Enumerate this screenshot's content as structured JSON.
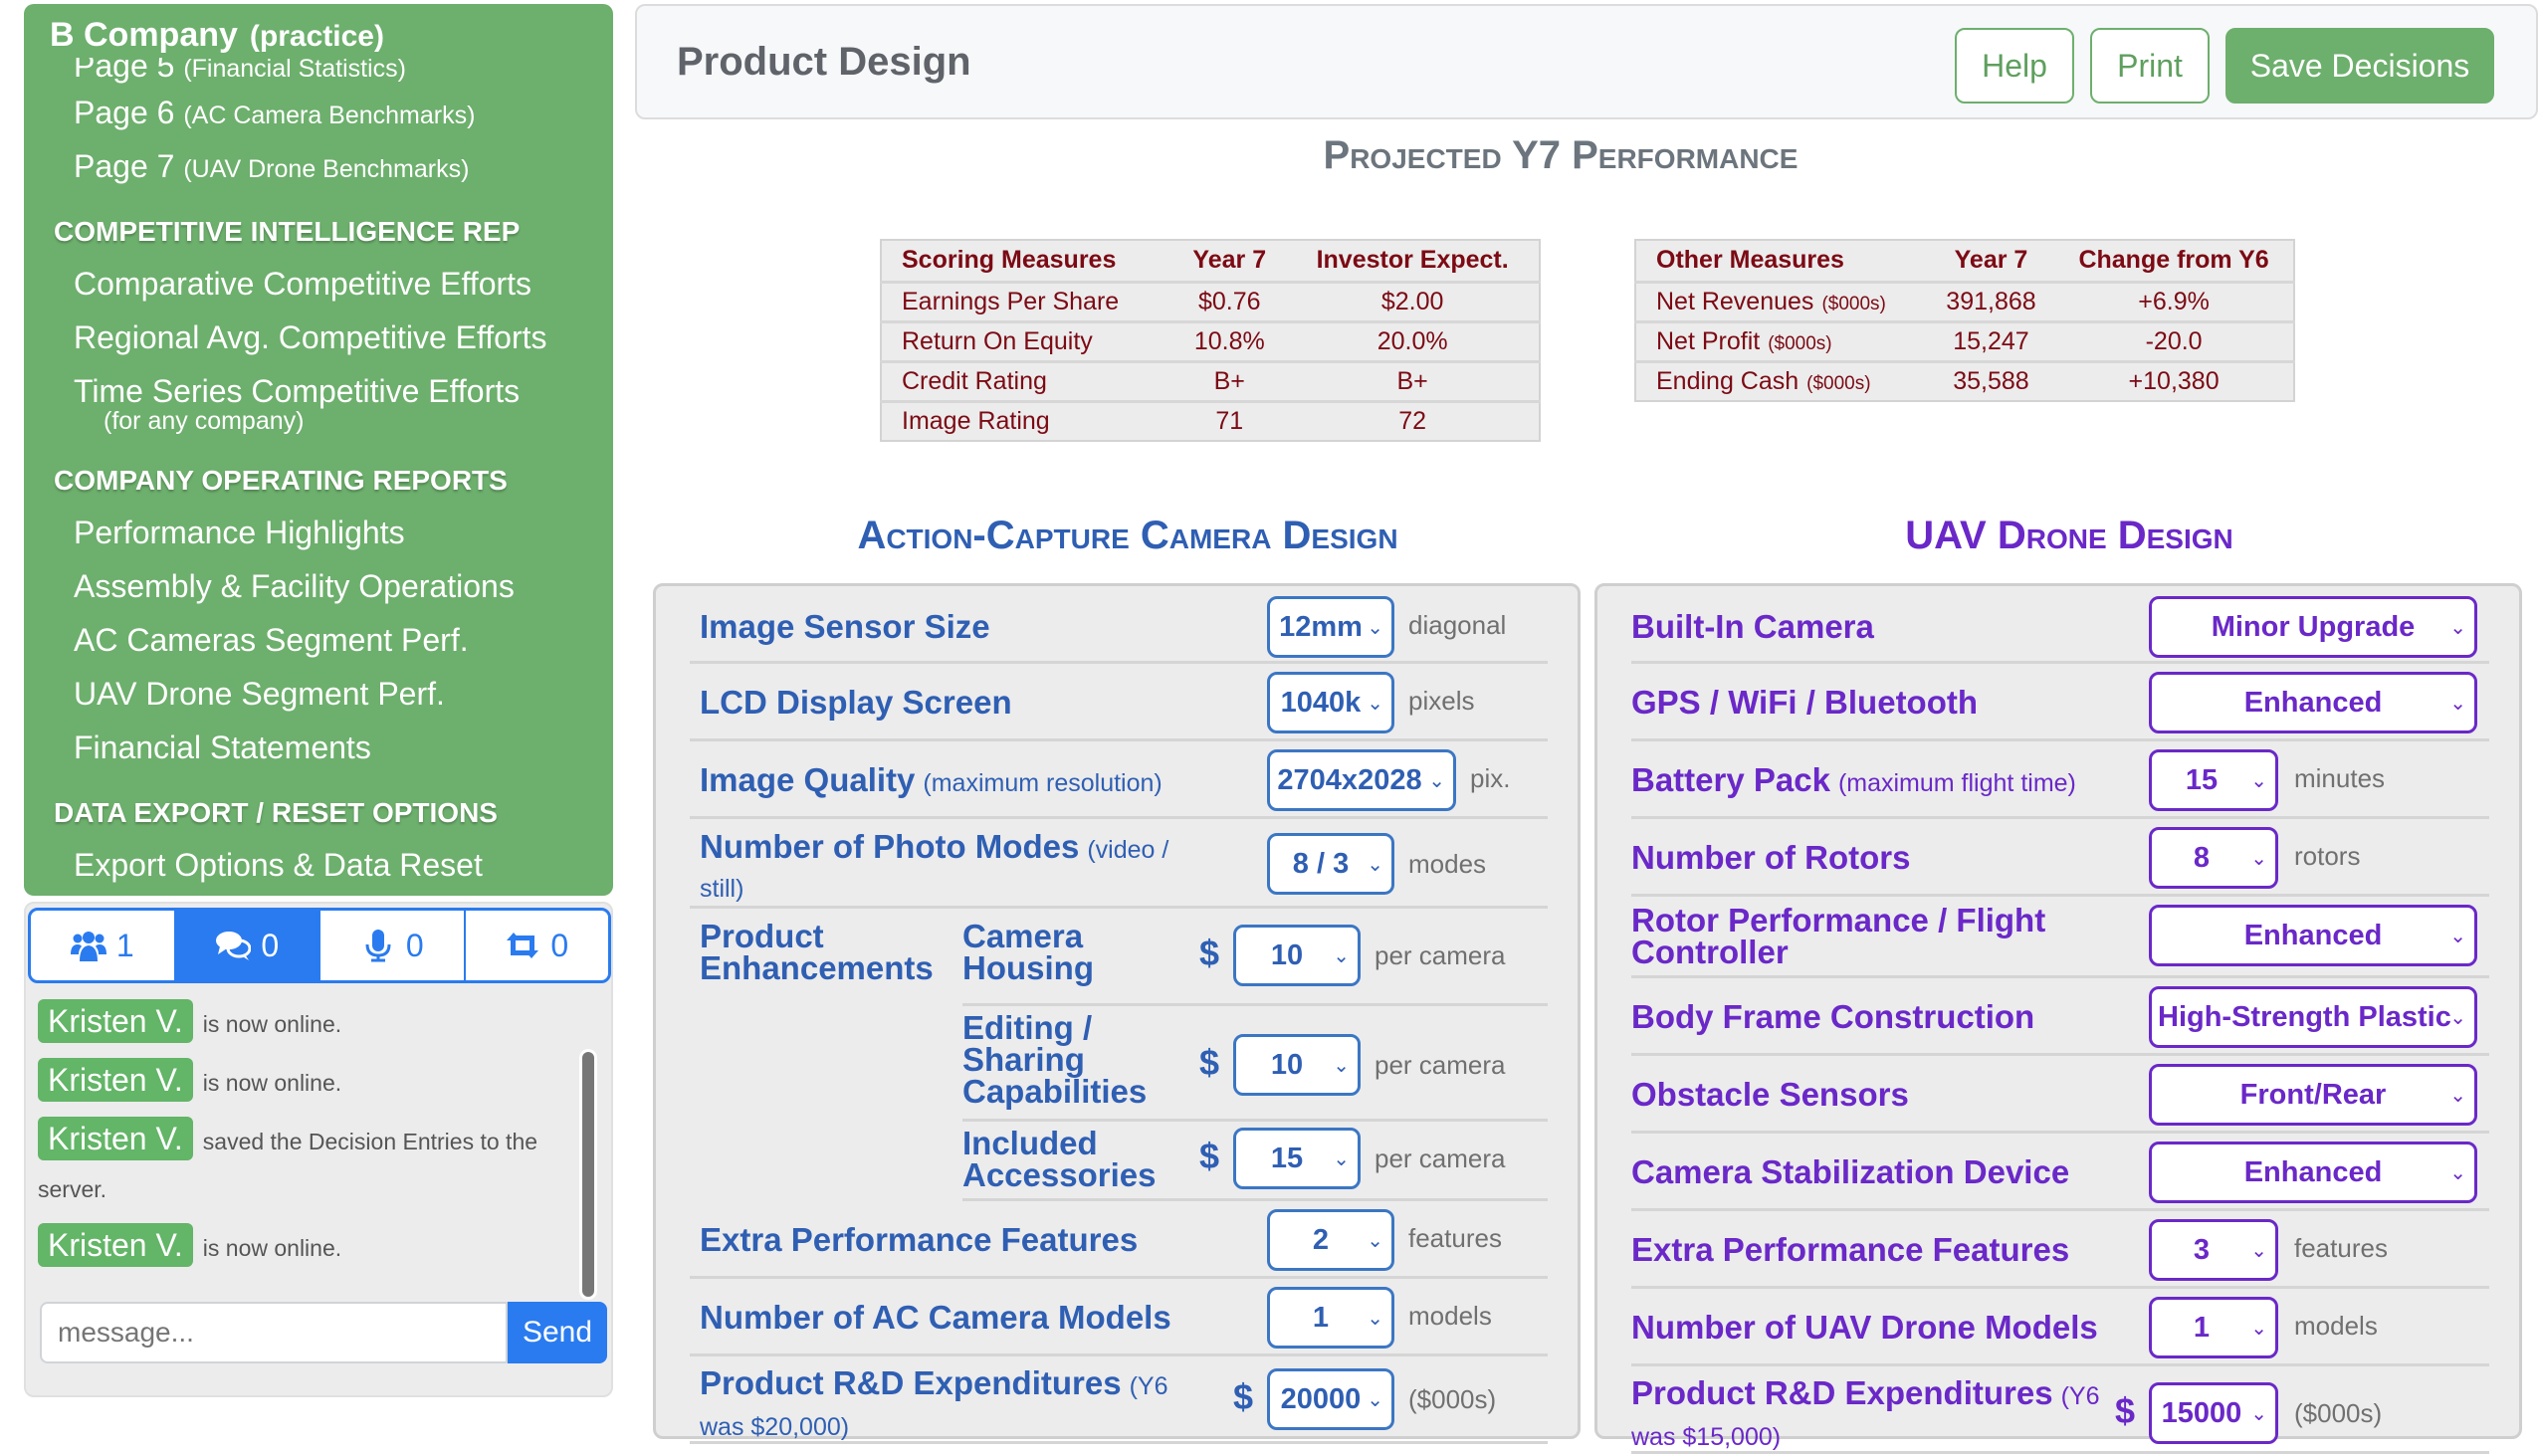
{
  "sidebar": {
    "company": "B Company",
    "practice": "(practice)",
    "items_top": [
      {
        "label": "Page 5",
        "sub": "(Financial Statistics)"
      },
      {
        "label": "Page 6",
        "sub": "(AC Camera Benchmarks)"
      },
      {
        "label": "Page 7",
        "sub": "(UAV Drone Benchmarks)"
      }
    ],
    "sections": [
      {
        "heading": "COMPETITIVE INTELLIGENCE REP",
        "items": [
          "Comparative Competitive Efforts",
          "Regional Avg. Competitive Efforts",
          "Time Series Competitive Efforts"
        ],
        "note": "(for any company)"
      },
      {
        "heading": "COMPANY OPERATING REPORTS",
        "items": [
          "Performance Highlights",
          "Assembly & Facility Operations",
          "AC Cameras Segment Perf.",
          "UAV Drone Segment Perf.",
          "Financial Statements"
        ]
      },
      {
        "heading": "DATA EXPORT / RESET OPTIONS",
        "items": [
          "Export Options & Data Reset"
        ]
      }
    ]
  },
  "chat": {
    "tabs": [
      {
        "icon": "users-icon",
        "count": "1"
      },
      {
        "icon": "comments-icon",
        "count": "0"
      },
      {
        "icon": "microphone-icon",
        "count": "0"
      },
      {
        "icon": "retweet-icon",
        "count": "0"
      }
    ],
    "messages": [
      {
        "user": "Kristen V.",
        "text": "is now online."
      },
      {
        "user": "Kristen V.",
        "text": "is now online."
      },
      {
        "user": "Kristen V.",
        "text": "saved the Decision Entries to the server."
      },
      {
        "user": "Kristen V.",
        "text": "is now online."
      }
    ],
    "input_placeholder": "message...",
    "send_label": "Send"
  },
  "header": {
    "title": "Product Design",
    "help": "Help",
    "print": "Print",
    "save": "Save Decisions"
  },
  "projected": {
    "title": "Projected Y7 Performance",
    "scoring": {
      "headers": [
        "Scoring Measures",
        "Year 7",
        "Investor Expect."
      ],
      "rows": [
        [
          "Earnings Per Share",
          "$0.76",
          "$2.00"
        ],
        [
          "Return On Equity",
          "10.8%",
          "20.0%"
        ],
        [
          "Credit Rating",
          "B+",
          "B+"
        ],
        [
          "Image Rating",
          "71",
          "72"
        ]
      ]
    },
    "other": {
      "headers": [
        "Other Measures",
        "Year 7",
        "Change from Y6"
      ],
      "rows": [
        [
          "Net Revenues",
          "($000s)",
          "391,868",
          "+6.9%"
        ],
        [
          "Net Profit",
          "($000s)",
          "15,247",
          "-20.0"
        ],
        [
          "Ending Cash",
          "($000s)",
          "35,588",
          "+10,380"
        ]
      ]
    }
  },
  "ac": {
    "title": "Action-Capture Camera Design",
    "sensor": {
      "label": "Image Sensor Size",
      "value": "12mm",
      "unit": "diagonal"
    },
    "lcd": {
      "label": "LCD Display Screen",
      "value": "1040k",
      "unit": "pixels"
    },
    "quality": {
      "label": "Image Quality",
      "note": "(maximum resolution)",
      "value": "2704x2028",
      "unit": "pix."
    },
    "modes": {
      "label": "Number of Photo Modes",
      "note": "(video / still)",
      "value": "8 / 3",
      "unit": "modes"
    },
    "enh_label": "Product Enhancements",
    "housing": {
      "label": "Camera Housing",
      "value": "10",
      "unit": "per camera"
    },
    "editing": {
      "label": "Editing / Sharing Capabilities",
      "value": "10",
      "unit": "per camera"
    },
    "accessories": {
      "label": "Included Accessories",
      "value": "15",
      "unit": "per camera"
    },
    "extra": {
      "label": "Extra Performance Features",
      "value": "2",
      "unit": "features"
    },
    "models": {
      "label": "Number of AC Camera Models",
      "value": "1",
      "unit": "models"
    },
    "rd": {
      "label": "Product R&D Expenditures",
      "note": "(Y6 was $20,000)",
      "value": "20000",
      "unit": "($000s)"
    }
  },
  "uav": {
    "title": "UAV Drone Design",
    "camera": {
      "label": "Built-In Camera",
      "value": "Minor Upgrade"
    },
    "gps": {
      "label": "GPS / WiFi / Bluetooth",
      "value": "Enhanced"
    },
    "battery": {
      "label": "Battery Pack",
      "note": "(maximum flight time)",
      "value": "15",
      "unit": "minutes"
    },
    "rotors": {
      "label": "Number of Rotors",
      "value": "8",
      "unit": "rotors"
    },
    "rotorperf": {
      "label": "Rotor Performance / Flight Controller",
      "value": "Enhanced"
    },
    "frame": {
      "label": "Body Frame Construction",
      "value": "High-Strength Plastic"
    },
    "obstacle": {
      "label": "Obstacle Sensors",
      "value": "Front/Rear"
    },
    "stabil": {
      "label": "Camera Stabilization Device",
      "value": "Enhanced"
    },
    "extra": {
      "label": "Extra Performance Features",
      "value": "3",
      "unit": "features"
    },
    "models": {
      "label": "Number of UAV Drone Models",
      "value": "1",
      "unit": "models"
    },
    "rd": {
      "label": "Product R&D Expenditures",
      "note": "(Y6 was $15,000)",
      "value": "15000",
      "unit": "($000s)"
    }
  },
  "symbols": {
    "dollar": "$",
    "chevron": "⌄"
  }
}
